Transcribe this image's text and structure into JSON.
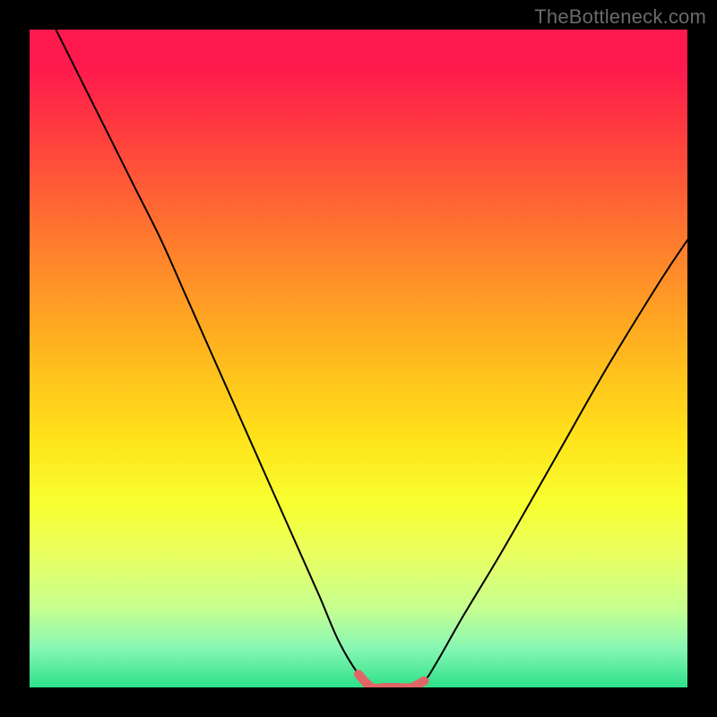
{
  "watermark": "TheBottleneck.com",
  "chart_data": {
    "type": "line",
    "title": "",
    "xlabel": "",
    "ylabel": "",
    "xlim": [
      0,
      100
    ],
    "ylim": [
      0,
      100
    ],
    "series": [
      {
        "name": "bottleneck-curve",
        "x": [
          0,
          4,
          8,
          12,
          16,
          20,
          24,
          28,
          32,
          36,
          40,
          44,
          47,
          50,
          52,
          54,
          56,
          58,
          60,
          62,
          66,
          72,
          80,
          88,
          96,
          100
        ],
        "values": [
          108,
          100,
          92,
          84,
          76,
          68,
          59,
          50,
          41,
          32,
          23,
          14,
          7,
          2,
          0,
          0,
          0,
          0,
          1,
          4,
          11,
          21,
          35,
          49,
          62,
          68
        ]
      },
      {
        "name": "flat-bottom-highlight",
        "x": [
          50,
          52,
          54,
          56,
          58,
          60
        ],
        "values": [
          2,
          0,
          0,
          0,
          0,
          1
        ]
      }
    ],
    "annotations": []
  }
}
